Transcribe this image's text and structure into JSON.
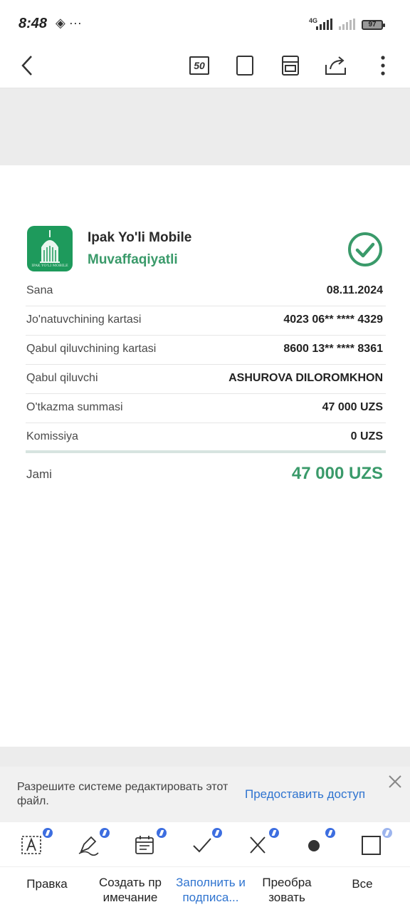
{
  "status_bar": {
    "time": "8:48",
    "extra_icons": "◈ ···",
    "network": "4G",
    "battery": "97"
  },
  "toolbar": {
    "page_count": "50"
  },
  "receipt": {
    "bank_name": "Ipak Yo'li Mobile",
    "status": "Muvaffaqiyatli",
    "logo_text": "IPAK YO'LI MOBILE",
    "rows": [
      {
        "label": "Sana",
        "value": "08.11.2024"
      },
      {
        "label": "Jo'natuvchining kartasi",
        "value": "4023 06** **** 4329"
      },
      {
        "label": "Qabul qiluvchining kartasi",
        "value": "8600 13** **** 8361"
      },
      {
        "label": "Qabul qiluvchi",
        "value": "ASHUROVA DILOROMKHON"
      },
      {
        "label": "O'tkazma summasi",
        "value": "47 000 UZS"
      },
      {
        "label": "Komissiya",
        "value": "0 UZS"
      }
    ],
    "total_label": "Jami",
    "total_value": "47 000 UZS"
  },
  "banner": {
    "text": "Разрешите системе редактировать этот файл.",
    "action": "Предоставить доступ"
  },
  "bottom_tools": [
    {
      "label": "Правка",
      "icon": "text-box-icon"
    },
    {
      "label": "Создать пр имечание",
      "icon": "pen-icon"
    },
    {
      "label": "Заполнить и подписа...",
      "icon": "calendar-form-icon"
    },
    {
      "label": "Преобра зовать",
      "icon": "check-icon"
    },
    {
      "label": "Все",
      "icon": "square-icon"
    }
  ],
  "colors": {
    "accent_green": "#3a9a6a",
    "logo_green": "#1e9a5c",
    "link_blue": "#2f74d0"
  }
}
